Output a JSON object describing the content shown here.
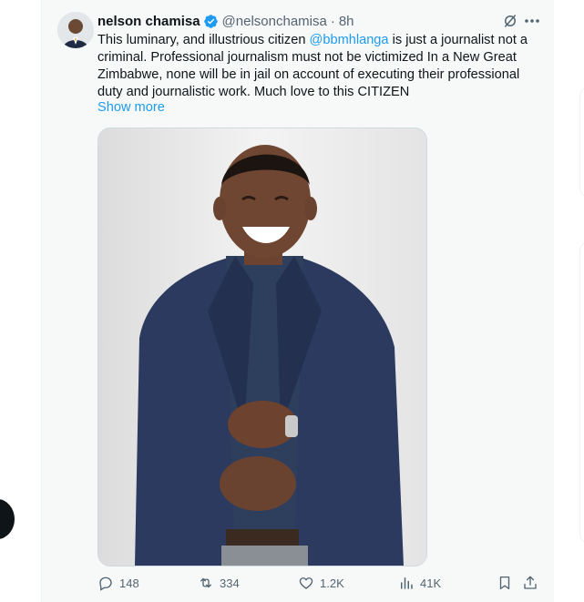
{
  "tweet": {
    "author_name": "nelson chamisa",
    "author_handle": "@nelsonchamisa",
    "separator": "·",
    "time": "8h",
    "text_part1": "This luminary, and illustrious citizen ",
    "mention": "@bbmhlanga",
    "text_part2": " is just a journalist not a criminal. Professional journalism must not be victimized  In a New Great Zimbabwe, none will be in jail on account of executing their professional duty and journalistic work. Much love to this CITIZEN",
    "show_more": "Show more"
  },
  "actions": {
    "replies": "148",
    "reposts": "334",
    "likes": "1.2K",
    "views": "41K"
  },
  "icons": {
    "verified": "verified-badge-icon",
    "grok": "grok-icon",
    "more": "more-icon",
    "reply": "reply-icon",
    "repost": "repost-icon",
    "like": "like-icon",
    "views": "views-icon",
    "bookmark": "bookmark-icon",
    "share": "share-icon"
  },
  "colors": {
    "accent": "#1d9bf0",
    "text": "#0f1419",
    "muted": "#536471",
    "background": "#f7f9f9"
  }
}
